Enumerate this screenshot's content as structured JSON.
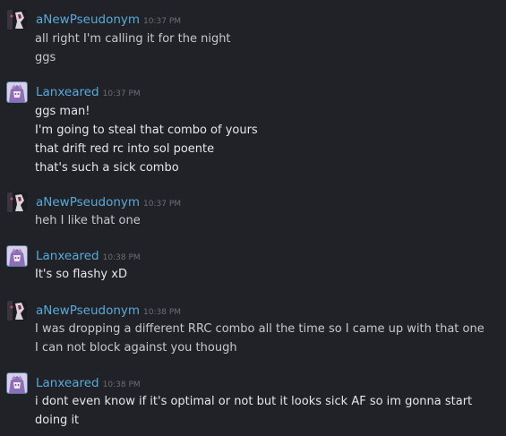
{
  "messages": [
    {
      "sender": "aNewPseudonym",
      "time": "10:37 PM",
      "avatar": "pseudonym-avatar",
      "lines": [
        "all right I'm calling it for the night",
        "ggs"
      ]
    },
    {
      "sender": "Lanxeared",
      "time": "10:37 PM",
      "avatar": "lanxeared-avatar",
      "lines": [
        "ggs man!",
        "I'm going to steal that combo of yours",
        "that drift red rc into sol poente",
        "that's such a sick combo"
      ]
    },
    {
      "sender": "aNewPseudonym",
      "time": "10:37 PM",
      "avatar": "pseudonym-avatar",
      "lines": [
        "heh I like that one"
      ]
    },
    {
      "sender": "Lanxeared",
      "time": "10:38 PM",
      "avatar": "lanxeared-avatar",
      "lines": [
        "It's so flashy xD"
      ]
    },
    {
      "sender": "aNewPseudonym",
      "time": "10:38 PM",
      "avatar": "pseudonym-avatar",
      "lines": [
        "I was dropping a different RRC combo all the time so I came up with that one",
        "I can not block against you though"
      ]
    },
    {
      "sender": "Lanxeared",
      "time": "10:38 PM",
      "avatar": "lanxeared-avatar",
      "lines": [
        "i dont even know if it's optimal or not but it looks sick AF so im gonna start doing it"
      ]
    }
  ],
  "colors": {
    "background": "#202227",
    "sender": "#5aa9d8",
    "timestamp": "#6a6e76",
    "text": "#c6c8cc"
  }
}
